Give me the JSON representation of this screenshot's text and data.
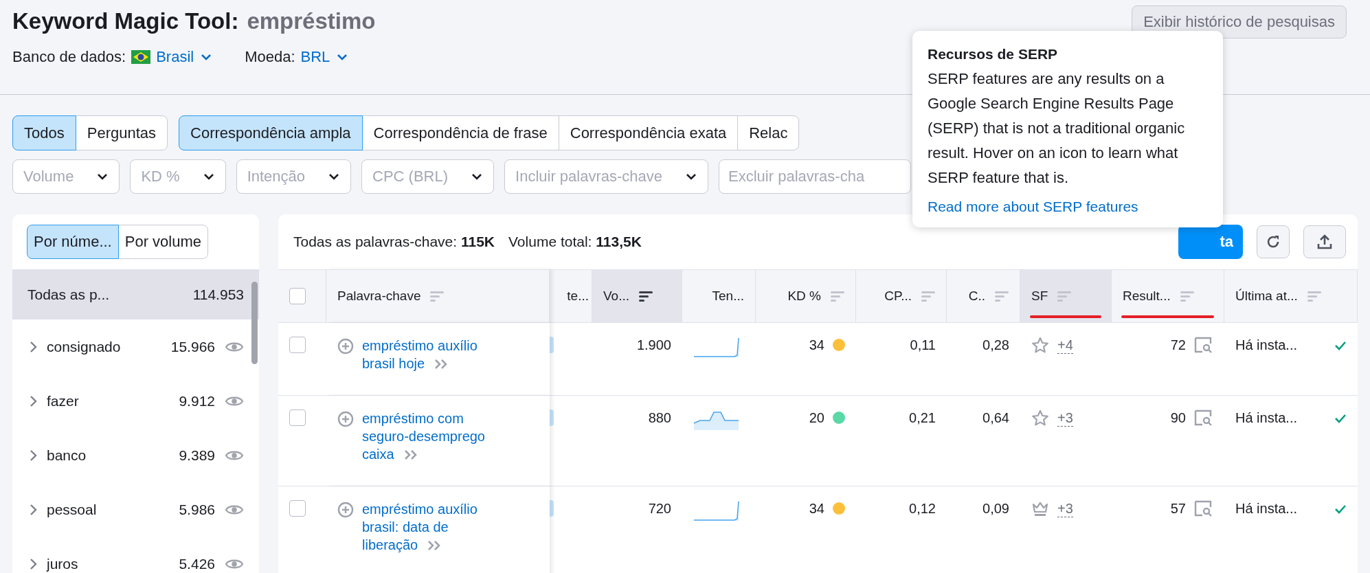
{
  "header": {
    "title": "Keyword Magic Tool:",
    "query": "empréstimo",
    "history_button": "Exibir histórico de pesquisas",
    "database_label": "Banco de dados:",
    "database": "Brasil",
    "currency_label": "Moeda:",
    "currency": "BRL"
  },
  "question_tabs": [
    {
      "label": "Todos",
      "selected": true
    },
    {
      "label": "Perguntas",
      "selected": false
    }
  ],
  "match_tabs": [
    {
      "label": "Correspondência ampla",
      "selected": true
    },
    {
      "label": "Correspondência de frase",
      "selected": false
    },
    {
      "label": "Correspondência exata",
      "selected": false
    },
    {
      "label": "Relac",
      "selected": false
    }
  ],
  "filters": [
    {
      "label": "Volume",
      "kind": "dropdown"
    },
    {
      "label": "KD %",
      "kind": "dropdown"
    },
    {
      "label": "Intenção",
      "kind": "dropdown"
    },
    {
      "label": "CPC (BRL)",
      "kind": "dropdown"
    },
    {
      "label": "Incluir palavras-chave",
      "kind": "dropdown"
    },
    {
      "placeholder": "Excluir palavras-cha",
      "kind": "input"
    }
  ],
  "sidebar": {
    "sort_tabs": [
      {
        "label": "Por núme...",
        "selected": true
      },
      {
        "label": "Por volume",
        "selected": false
      }
    ],
    "groups": [
      {
        "label": "Todas as p...",
        "count": "114.953",
        "kind": "total",
        "selected": true
      },
      {
        "label": "consignado",
        "count": "15.966",
        "kind": "group",
        "selected": false
      },
      {
        "label": "fazer",
        "count": "9.912",
        "kind": "group",
        "selected": false
      },
      {
        "label": "banco",
        "count": "9.389",
        "kind": "group",
        "selected": false
      },
      {
        "label": "pessoal",
        "count": "5.986",
        "kind": "group",
        "selected": false
      },
      {
        "label": "juros",
        "count": "5.426",
        "kind": "group",
        "selected": false
      }
    ]
  },
  "table": {
    "summary": [
      {
        "label": "Todas as palavras-chave:",
        "value": "115K"
      },
      {
        "label": "Volume total:",
        "value": "113,5K"
      }
    ],
    "action_button": "ta",
    "select_all_checked": false,
    "columns": [
      {
        "label": "Palavra-chave",
        "sortable": true,
        "sorted": false,
        "hovered": false,
        "underlined": false
      },
      {
        "label": "te...",
        "sortable": false,
        "sorted": false,
        "hovered": false,
        "underlined": false
      },
      {
        "label": "Vo...",
        "sortable": true,
        "sorted": true,
        "hovered": false,
        "underlined": false
      },
      {
        "label": "Ten...",
        "sortable": false,
        "sorted": false,
        "hovered": false,
        "underlined": false
      },
      {
        "label": "KD %",
        "sortable": true,
        "sorted": false,
        "hovered": false,
        "underlined": false
      },
      {
        "label": "CP...",
        "sortable": true,
        "sorted": false,
        "hovered": false,
        "underlined": false
      },
      {
        "label": "C..",
        "sortable": true,
        "sorted": false,
        "hovered": false,
        "underlined": false
      },
      {
        "label": "SF",
        "sortable": true,
        "sorted": false,
        "hovered": true,
        "underlined": true
      },
      {
        "label": "Result...",
        "sortable": true,
        "sorted": false,
        "hovered": false,
        "underlined": true
      },
      {
        "label": "Última at...",
        "sortable": true,
        "sorted": false,
        "hovered": false,
        "underlined": false
      }
    ],
    "rows": [
      {
        "checked": false,
        "keyword": "empréstimo auxílio brasil hoje",
        "volume": "1.900",
        "trend": {
          "kind": "spike"
        },
        "kd": "34",
        "color": "#fcbf3a",
        "cpc": "0,11",
        "com": "0,28",
        "serp": {
          "kind": "star",
          "more": "+4"
        },
        "results": "72",
        "updated": "Há insta..."
      },
      {
        "checked": false,
        "keyword": "empréstimo com seguro-desemprego caixa",
        "volume": "880",
        "trend": {
          "kind": "bump"
        },
        "kd": "20",
        "color": "#5ad8a6",
        "cpc": "0,21",
        "com": "0,64",
        "serp": {
          "kind": "star",
          "more": "+3"
        },
        "results": "90",
        "updated": "Há insta..."
      },
      {
        "checked": false,
        "keyword": "empréstimo auxílio brasil: data de liberação",
        "volume": "720",
        "trend": {
          "kind": "spike"
        },
        "kd": "34",
        "color": "#fcbf3a",
        "cpc": "0,12",
        "com": "0,09",
        "serp": {
          "kind": "crown",
          "more": "+3"
        },
        "results": "57",
        "updated": "Há insta..."
      }
    ]
  },
  "tooltip": {
    "title": "Recursos de SERP",
    "body": "SERP features are any results on a Google Search Engine Results Page (SERP) that is not a traditional organic result. Hover on an icon to learn what SERP feature that is.",
    "link": "Read more about SERP features"
  }
}
